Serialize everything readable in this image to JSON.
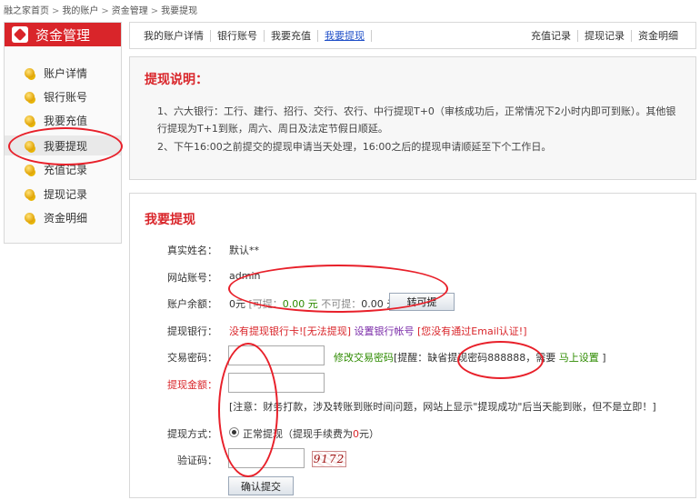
{
  "breadcrumb": [
    "融之家首页",
    "我的账户",
    "资金管理",
    "我要提现"
  ],
  "sidebar": {
    "title": "资金管理",
    "items": [
      {
        "label": "账户详情"
      },
      {
        "label": "银行账号"
      },
      {
        "label": "我要充值"
      },
      {
        "label": "我要提现"
      },
      {
        "label": "充值记录"
      },
      {
        "label": "提现记录"
      },
      {
        "label": "资金明细"
      }
    ]
  },
  "tabs": {
    "left": [
      "我的账户详情",
      "银行账号",
      "我要充值",
      "我要提现"
    ],
    "right": [
      "充值记录",
      "提现记录",
      "资金明细"
    ]
  },
  "notice": {
    "title": "提现说明：",
    "line1": "1、六大银行：工行、建行、招行、交行、农行、中行提现T+0（审核成功后，正常情况下2小时内即可到账）。其他银行提现为T+1到账，周六、周日及法定节假日顺延。",
    "line2": "2、下午16:00之前提交的提现申请当天处理，16:00之后的提现申请顺延至下个工作日。"
  },
  "form": {
    "title": "我要提现",
    "real_name": {
      "label": "真实姓名：",
      "value": "默认**"
    },
    "username": {
      "label": "网站账号：",
      "value": "admin"
    },
    "balance": {
      "label": "账户余额：",
      "amount": "0元",
      "withdrawable_label": "[可提：",
      "withdrawable": "0.00",
      "withdrawable_unit": "元",
      "frozen_label": "不可提：",
      "frozen": "0.00",
      "frozen_unit": "元]",
      "button": "转可提"
    },
    "bank": {
      "label": "提现银行：",
      "no_bank": "没有提现银行卡![无法提现]",
      "set_bank": "设置银行帐号",
      "email_warning": "[您没有通过Email认证!]"
    },
    "trade_password": {
      "label": "交易密码：",
      "modify_link": "修改交易密码",
      "hint_prefix": "[提醒：缺省提现密码888888，需要",
      "set_now": "马上设置",
      "hint_suffix": "]"
    },
    "amount": {
      "label": "提现金额："
    },
    "note": "[注意：财务打款，涉及转账到账时间问题，网站上显示\"提现成功\"后当天能到账，但不是立即！]",
    "method": {
      "label": "提现方式：",
      "option": "正常提现",
      "fee_prefix": "（提现手续费为",
      "fee": "0",
      "fee_suffix": "元）"
    },
    "captcha": {
      "label": "验证码：",
      "image_text": "9172"
    },
    "submit": "确认提交"
  },
  "colors": {
    "brand_red": "#d9252a",
    "annotation_red": "#e8202a",
    "green": "#2e8b00",
    "link_blue": "#2050c8",
    "purple": "#7a2aa8"
  }
}
